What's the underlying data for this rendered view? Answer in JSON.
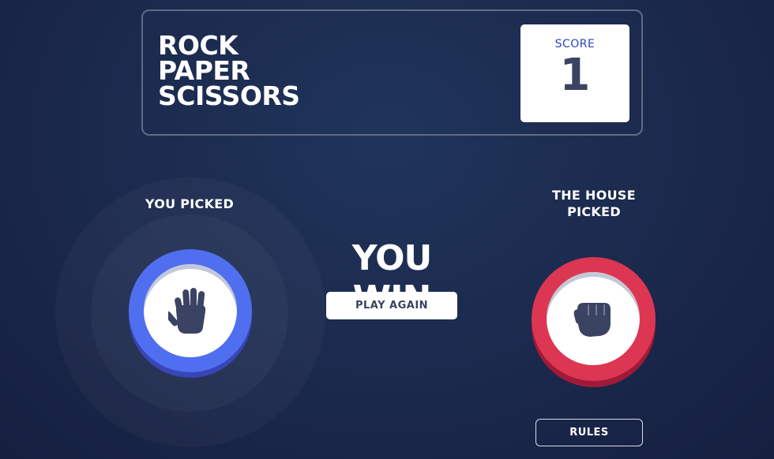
{
  "header": {
    "title_lines": [
      "ROCK",
      "PAPER",
      "SCISSORS"
    ],
    "score_label": "SCORE",
    "score_value": "1"
  },
  "player": {
    "label": "YOU PICKED",
    "choice": "paper",
    "icon": "paper-hand-icon",
    "color": "#4f6ff0"
  },
  "house": {
    "label": "THE HOUSE PICKED",
    "choice": "rock",
    "icon": "rock-fist-icon",
    "color": "#dd3652"
  },
  "result": {
    "text": "YOU WIN",
    "play_again_label": "PLAY AGAIN"
  },
  "footer": {
    "rules_label": "RULES"
  }
}
